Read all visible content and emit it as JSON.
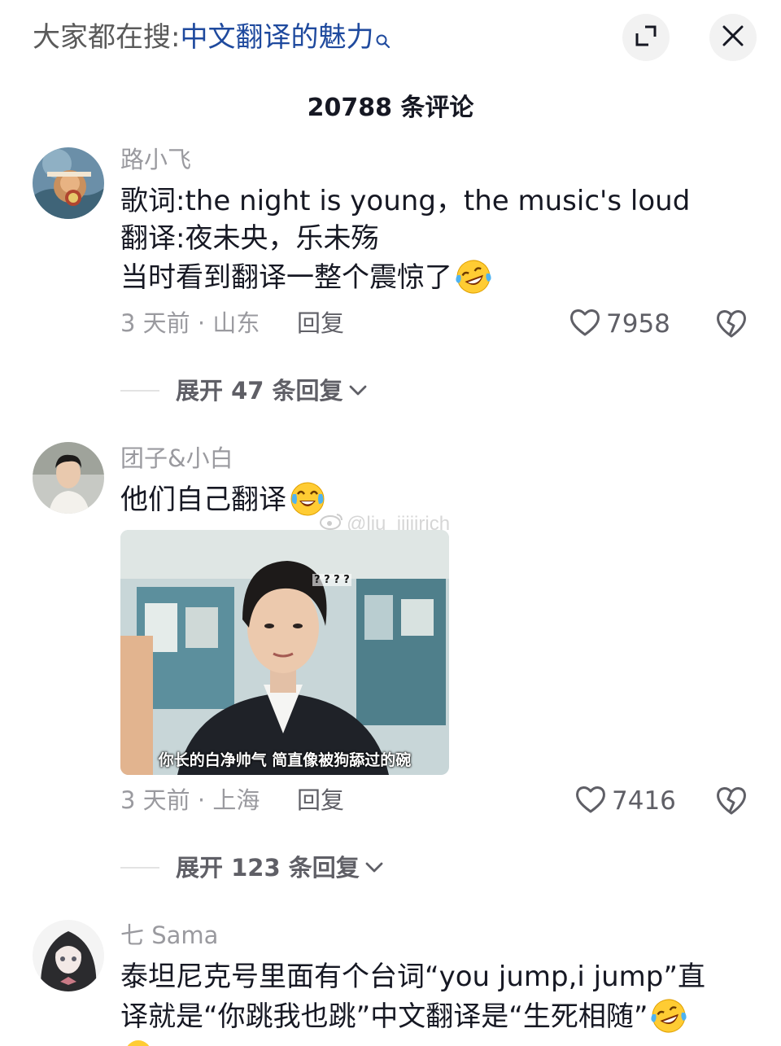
{
  "header": {
    "search_prefix": "大家都在搜:",
    "search_term": "中文翻译的魅力",
    "search_icon": "search-icon",
    "expand_icon": "expand-icon",
    "close_icon": "close-icon"
  },
  "comment_count": "20788 条评论",
  "comments": [
    {
      "username": "路小飞",
      "lines": [
        "歌词:the night is young，the music's loud",
        "翻译:夜未央，乐未殇",
        "当时看到翻译一整个震惊了"
      ],
      "emoji": "rolling-laugh-emoji",
      "meta": "3 天前 · 山东",
      "reply_label": "回复",
      "likes": "7958",
      "expand_label": "展开 47 条回复"
    },
    {
      "username": "团子&小白",
      "lines": [
        "他们自己翻译"
      ],
      "emoji": "crying-laugh-emoji",
      "image_caption": "你长的白净帅气 简直像被狗舔过的碗",
      "image_overlay_text": "? ? ? ?",
      "watermark": "@liu_iiiiirich",
      "meta": "3 天前 · 上海",
      "reply_label": "回复",
      "likes": "7416",
      "expand_label": "展开 123 条回复"
    },
    {
      "username": "七 Sama",
      "lines": [
        "泰坦尼克号里面有个台词“you jump,i jump”直",
        "译就是“你跳我也跳”中文翻译是“生死相随”"
      ],
      "emoji": "rolling-laugh-emoji"
    }
  ],
  "colors": {
    "search_term": "#1f4a9e",
    "secondary_text": "#9a9a9f",
    "primary_text": "#161823"
  }
}
